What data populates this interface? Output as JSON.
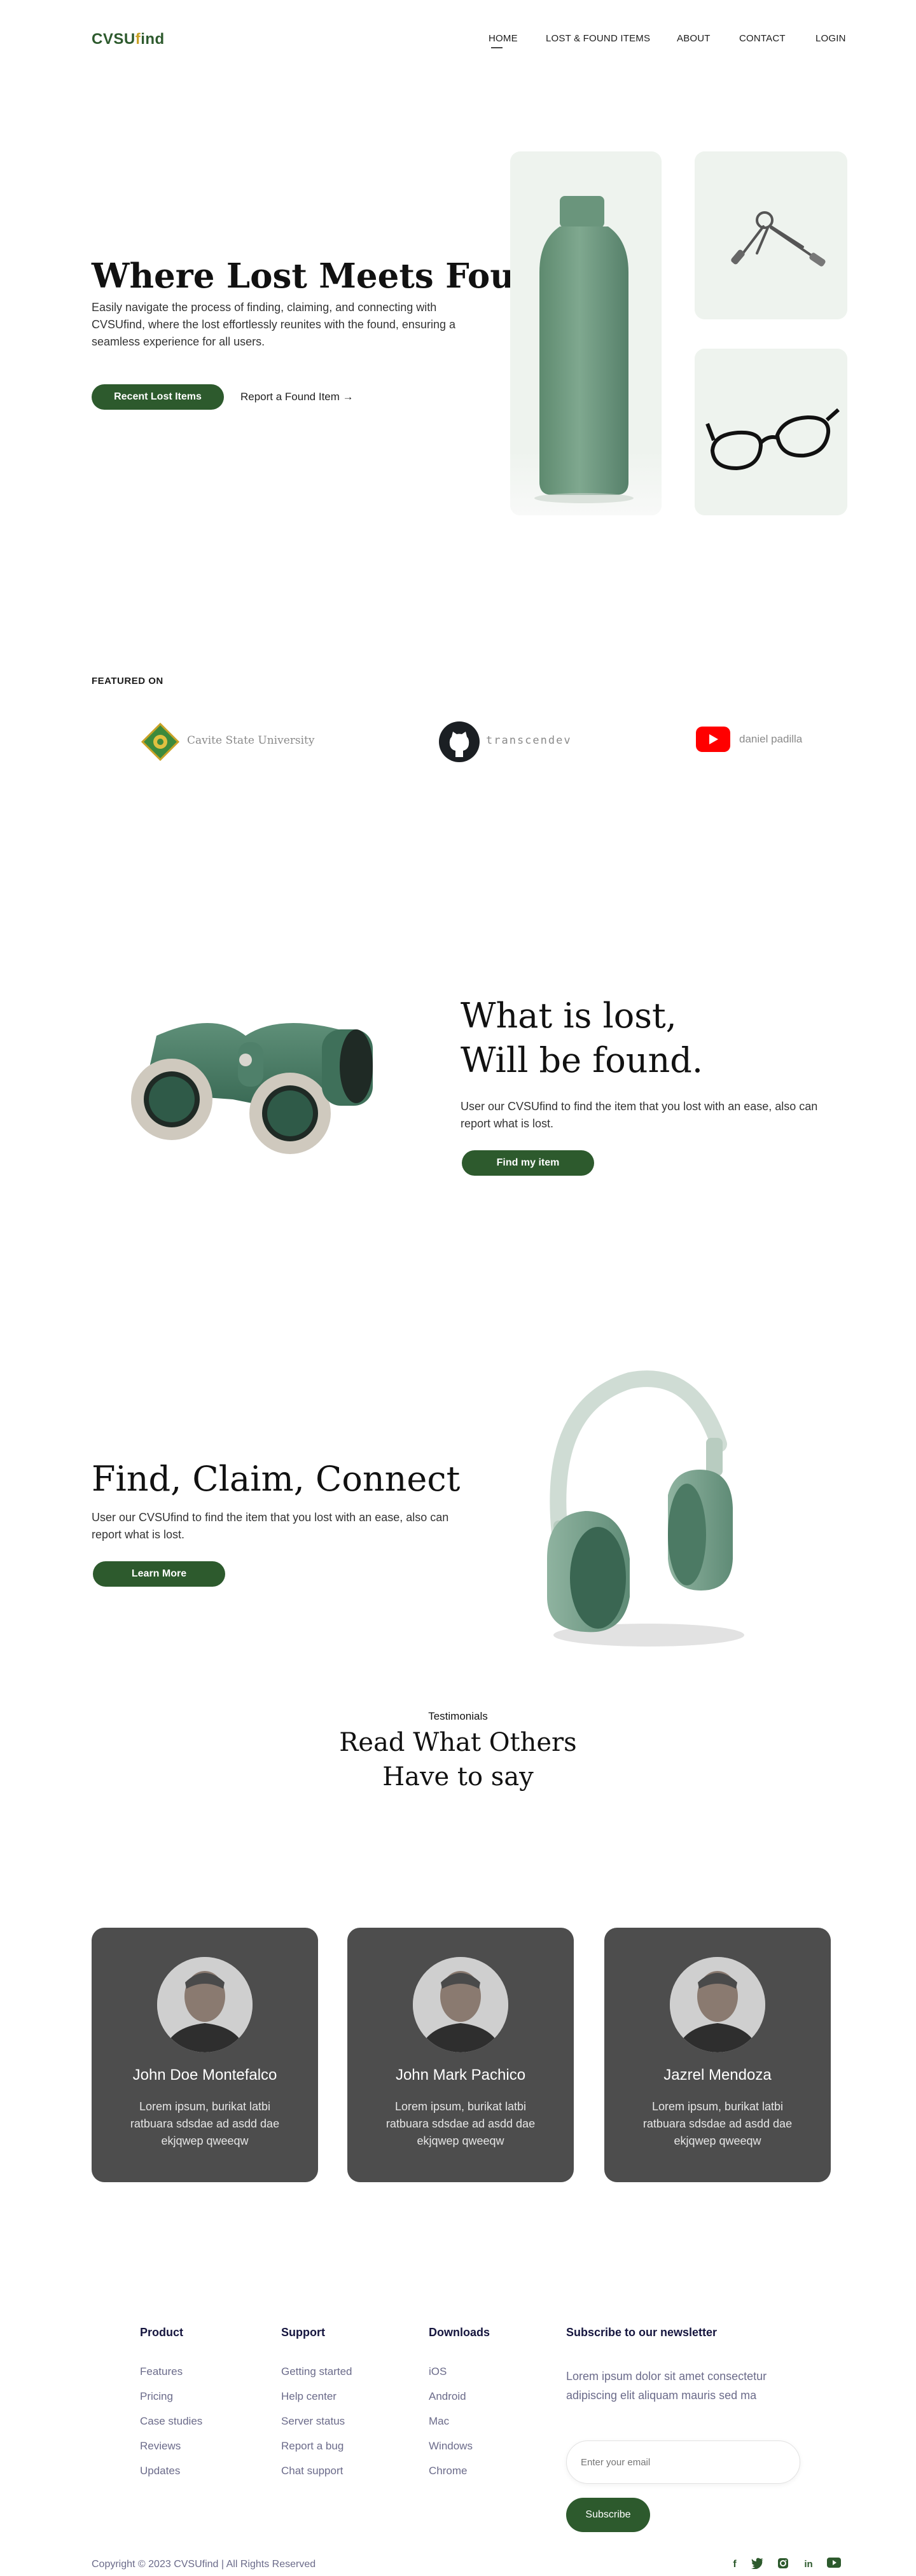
{
  "brand": {
    "name_start": "CVSU",
    "name_accent": "f",
    "name_end": "ind"
  },
  "nav": {
    "home": "HOME",
    "lost_found": "LOST & FOUND ITEMS",
    "about": "ABOUT",
    "contact": "CONTACT",
    "login": "LOGIN"
  },
  "hero": {
    "title": "Where Lost Meets Found.",
    "description": "Easily navigate the process of finding, claiming, and connecting with CVSUfind, where the lost effortlessly reunites with the found, ensuring a seamless experience for all users.",
    "primary_button": "Recent Lost Items",
    "secondary_link": "Report a Found Item →"
  },
  "featured": {
    "label": "FEATURED ON",
    "items": [
      "Cavite State University",
      "transcendev",
      "daniel padilla"
    ]
  },
  "section_lost": {
    "title_line1": "What is lost,",
    "title_line2": "Will be found.",
    "description": "User our CVSUfind to find the item that you lost with an ease, also can report what is lost.",
    "button": "Find my item"
  },
  "section_connect": {
    "title": "Find, Claim, Connect",
    "description": "User our CVSUfind to find the item that you lost with an ease, also can report what is lost.",
    "button": "Learn More"
  },
  "testimonials": {
    "eyebrow": "Testimonials",
    "title_line1": "Read What Others",
    "title_line2": "Have to say",
    "items": [
      {
        "name": "John Doe Montefalco",
        "text": "Lorem ipsum, burikat latbi ratbuara sdsdae ad asdd dae ekjqwep qweeqw"
      },
      {
        "name": "John Mark Pachico",
        "text": "Lorem ipsum, burikat latbi ratbuara sdsdae ad asdd dae ekjqwep qweeqw"
      },
      {
        "name": "Jazrel Mendoza",
        "text": "Lorem ipsum, burikat latbi ratbuara sdsdae ad asdd dae ekjqwep qweeqw"
      }
    ]
  },
  "footer": {
    "product": {
      "heading": "Product",
      "links": [
        "Features",
        "Pricing",
        "Case studies",
        "Reviews",
        "Updates"
      ]
    },
    "support": {
      "heading": "Support",
      "links": [
        "Getting started",
        "Help center",
        "Server status",
        "Report a bug",
        "Chat support"
      ]
    },
    "downloads": {
      "heading": "Downloads",
      "links": [
        "iOS",
        "Android",
        "Mac",
        "Windows",
        "Chrome"
      ]
    },
    "newsletter": {
      "heading": "Subscribe to our newsletter",
      "text": "Lorem ipsum dolor sit amet consectetur adipiscing elit aliquam mauris sed ma",
      "placeholder": "Enter your email",
      "button": "Subscribe"
    },
    "copyright": "Copyright © 2023 CVSUfind | All Rights Reserved",
    "social_icons": [
      "facebook-icon",
      "twitter-icon",
      "instagram-icon",
      "linkedin-icon",
      "youtube-icon"
    ]
  },
  "colors": {
    "brand_green": "#2d5a2d",
    "accent_gold": "#c9a227",
    "card_gray": "#4d4d4d",
    "footer_navy": "#16163f"
  }
}
